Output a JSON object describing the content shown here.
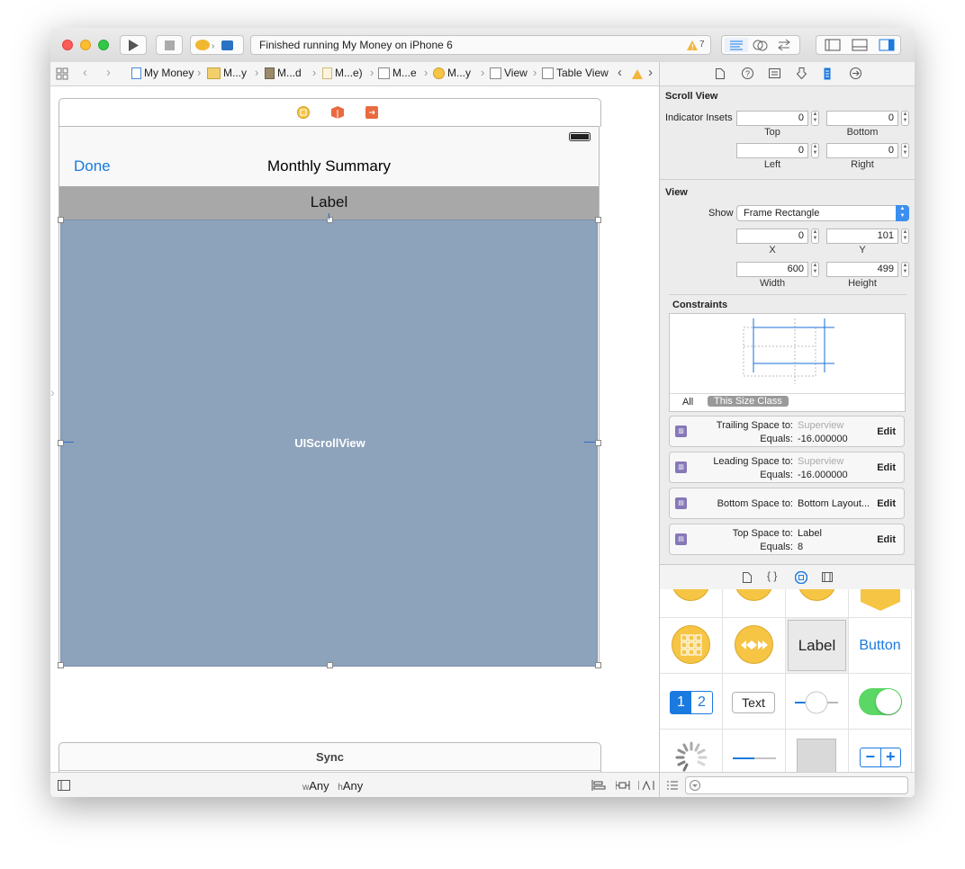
{
  "toolbar": {
    "status_text": "Finished running My Money on iPhone 6",
    "warning_count": "7"
  },
  "jumpbar": {
    "crumbs": [
      "My Money",
      "M...y",
      "M...d",
      "M...e)",
      "M...e",
      "M...y",
      "View",
      "Table View"
    ]
  },
  "canvas": {
    "nav_done": "Done",
    "nav_title": "Monthly Summary",
    "label_text": "Label",
    "scrollview_label": "UIScrollView",
    "sync_title": "Sync",
    "size_class_w_prefix": "w",
    "size_class_w": "Any",
    "size_class_h_prefix": "h",
    "size_class_h": "Any"
  },
  "inspector": {
    "scroll_view_title": "Scroll View",
    "indicator_insets_label": "Indicator Insets",
    "inset_top": "0",
    "inset_bottom": "0",
    "inset_left": "0",
    "inset_right": "0",
    "label_top": "Top",
    "label_bottom": "Bottom",
    "label_left": "Left",
    "label_right": "Right",
    "view_title": "View",
    "show_label": "Show",
    "show_value": "Frame Rectangle",
    "x_value": "0",
    "y_value": "101",
    "width_value": "600",
    "height_value": "499",
    "label_x": "X",
    "label_y": "Y",
    "label_width": "Width",
    "label_height": "Height",
    "constraints_title": "Constraints",
    "tab_all": "All",
    "tab_size_class": "This Size Class",
    "constraints": [
      {
        "line1_label": "Trailing Space to:",
        "line1_value": "Superview",
        "line2_label": "Equals:",
        "line2_value": "-16.000000",
        "edit": "Edit"
      },
      {
        "line1_label": "Leading Space to:",
        "line1_value": "Superview",
        "line2_label": "Equals:",
        "line2_value": "-16.000000",
        "edit": "Edit"
      },
      {
        "line1_label": "Bottom Space to:",
        "line1_value": "Bottom Layout...",
        "line2_label": "",
        "line2_value": "",
        "edit": "Edit"
      },
      {
        "line1_label": "Top Space to:",
        "line1_value": "Label",
        "line2_label": "Equals:",
        "line2_value": "8",
        "edit": "Edit"
      }
    ]
  },
  "library": {
    "label_item": "Label",
    "button_item": "Button",
    "segment_1": "1",
    "segment_2": "2",
    "text_item": "Text",
    "stepper_minus": "−",
    "stepper_plus": "+"
  },
  "colors": {
    "accent": "#1a7ae0",
    "scrollview": "#8da2bb",
    "label_bar": "#a8a8a8",
    "switch_on": "#5bd765"
  }
}
